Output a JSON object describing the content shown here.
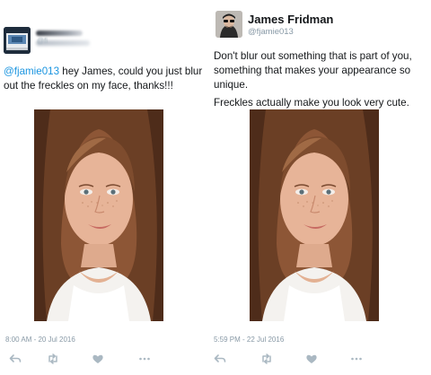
{
  "left_tweet": {
    "name_blurred": true,
    "handle_partial": "@fi",
    "mention": "@fjamie013",
    "text": " hey James, could you just blur out the freckles on my face, thanks!!!",
    "timestamp": "8:00 AM - 20 Jul 2016",
    "photo": "girl-with-freckles-photo"
  },
  "right_tweet": {
    "display_name": "James Fridman",
    "handle": "@fjamie013",
    "paragraph_1": "Don't blur out something that is part of you, something that makes your appearance so unique.",
    "paragraph_2": "Freckles actually make you look very cute.",
    "timestamp": "5:59 PM - 22 Jul 2016",
    "photo": "girl-with-freckles-photo"
  },
  "actions": [
    "reply-icon",
    "retweet-icon",
    "like-icon",
    "more-icon"
  ],
  "colors": {
    "link": "#1b95e0",
    "muted": "#8899a6",
    "text": "#14171a"
  }
}
